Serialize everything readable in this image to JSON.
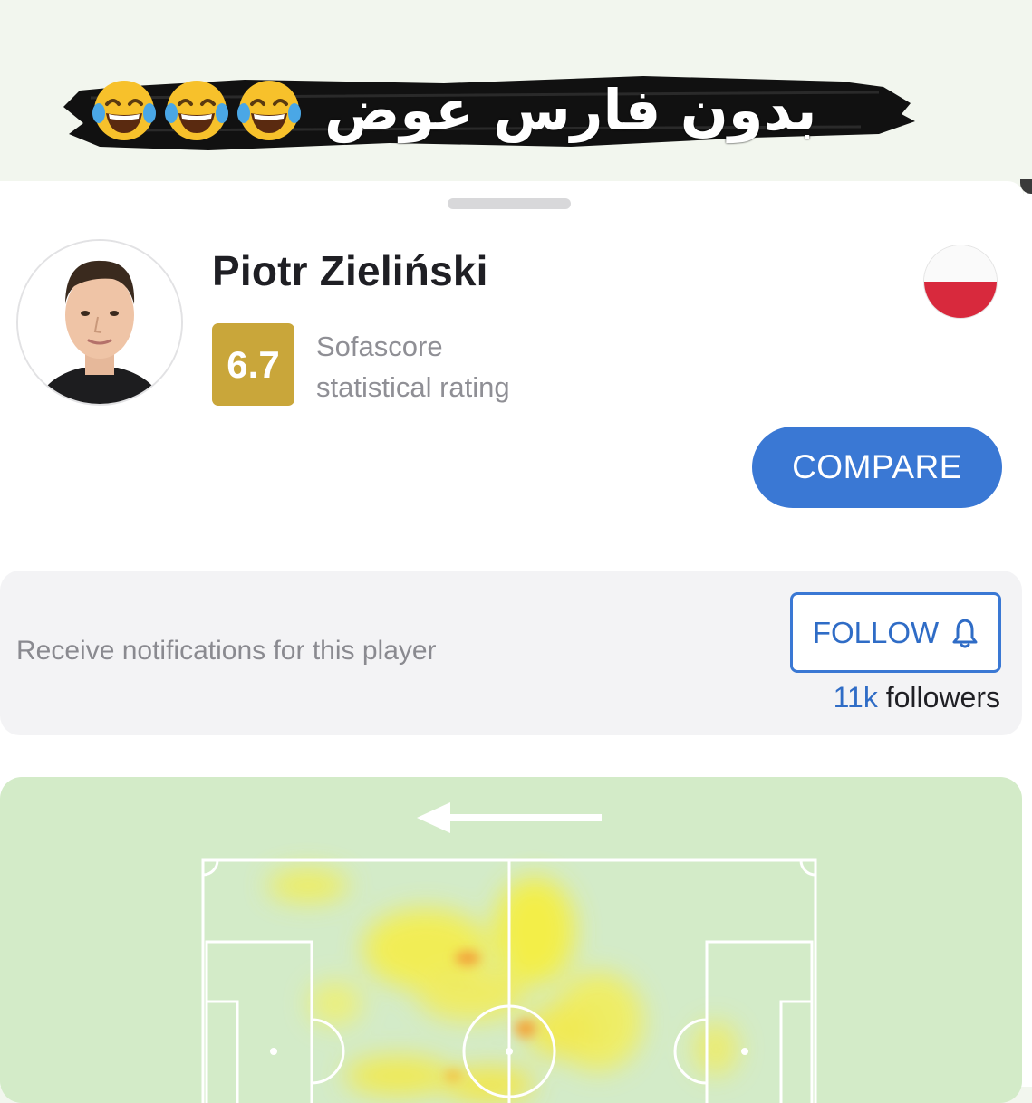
{
  "banner": {
    "caption": "بدون فارس عوض",
    "emojis": [
      "face-with-tears-of-joy-icon",
      "face-with-tears-of-joy-icon",
      "face-with-tears-of-joy-icon"
    ]
  },
  "player": {
    "name": "Piotr Zieliński",
    "rating": "6.7",
    "rating_label_line1": "Sofascore",
    "rating_label_line2": "statistical rating",
    "flag_icon": "poland-flag-icon"
  },
  "actions": {
    "compare_label": "COMPARE"
  },
  "notifications": {
    "prompt": "Receive notifications for this player",
    "follow_label": "FOLLOW",
    "followers_count": "11k",
    "followers_word": "followers"
  },
  "heatmap": {
    "direction_icon": "arrow-left-icon",
    "attack_direction": "left"
  },
  "colors": {
    "accent": "#3a78d4",
    "rating_badge": "#c9a63a",
    "pitch": "#d3ebc8",
    "flag_red": "#d8293d"
  }
}
